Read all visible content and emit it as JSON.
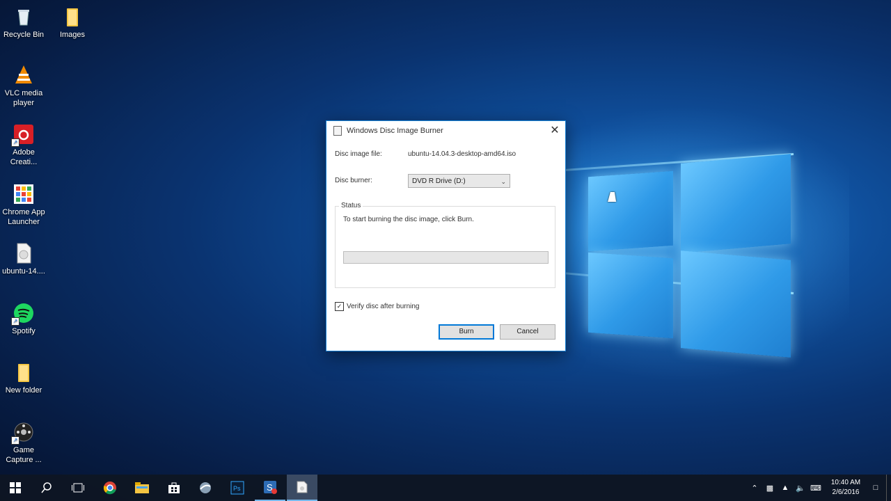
{
  "desktop": {
    "icons": [
      {
        "label": "Recycle Bin",
        "icon": "recycle-bin-icon"
      },
      {
        "label": "Images",
        "icon": "folder-icon"
      },
      {
        "label": "VLC media player",
        "icon": "vlc-icon"
      },
      {
        "label": "Adobe Creati...",
        "icon": "adobe-creative-cloud-icon"
      },
      {
        "label": "Chrome App Launcher",
        "icon": "chrome-app-launcher-icon"
      },
      {
        "label": "ubuntu-14....",
        "icon": "disc-image-file-icon"
      },
      {
        "label": "Spotify",
        "icon": "spotify-icon"
      },
      {
        "label": "New folder",
        "icon": "folder-icon"
      },
      {
        "label": "Game Capture ...",
        "icon": "game-capture-icon"
      }
    ]
  },
  "dialog": {
    "title": "Windows Disc Image Burner",
    "close_glyph": "✕",
    "disc_image_label": "Disc image file:",
    "disc_image_value": "ubuntu-14.04.3-desktop-amd64.iso",
    "disc_burner_label": "Disc burner:",
    "disc_burner_selected": "DVD R Drive (D:)",
    "status_legend": "Status",
    "status_text": "To start burning the disc image, click Burn.",
    "progress_fraction": 0,
    "verify_label": "Verify disc after burning",
    "verify_checked": true,
    "burn_label": "Burn",
    "cancel_label": "Cancel"
  },
  "taskbar": {
    "buttons": [
      "start-icon",
      "search-icon",
      "task-view-icon",
      "chrome-icon",
      "file-explorer-icon",
      "store-icon",
      "app-icon",
      "photoshop-icon",
      "snagit-icon",
      "disc-burner-icon"
    ],
    "tray": {
      "time": "10:40 AM",
      "date": "2/6/2016"
    }
  },
  "colors": {
    "accent": "#0078d7",
    "taskbar": "#0e1623"
  }
}
